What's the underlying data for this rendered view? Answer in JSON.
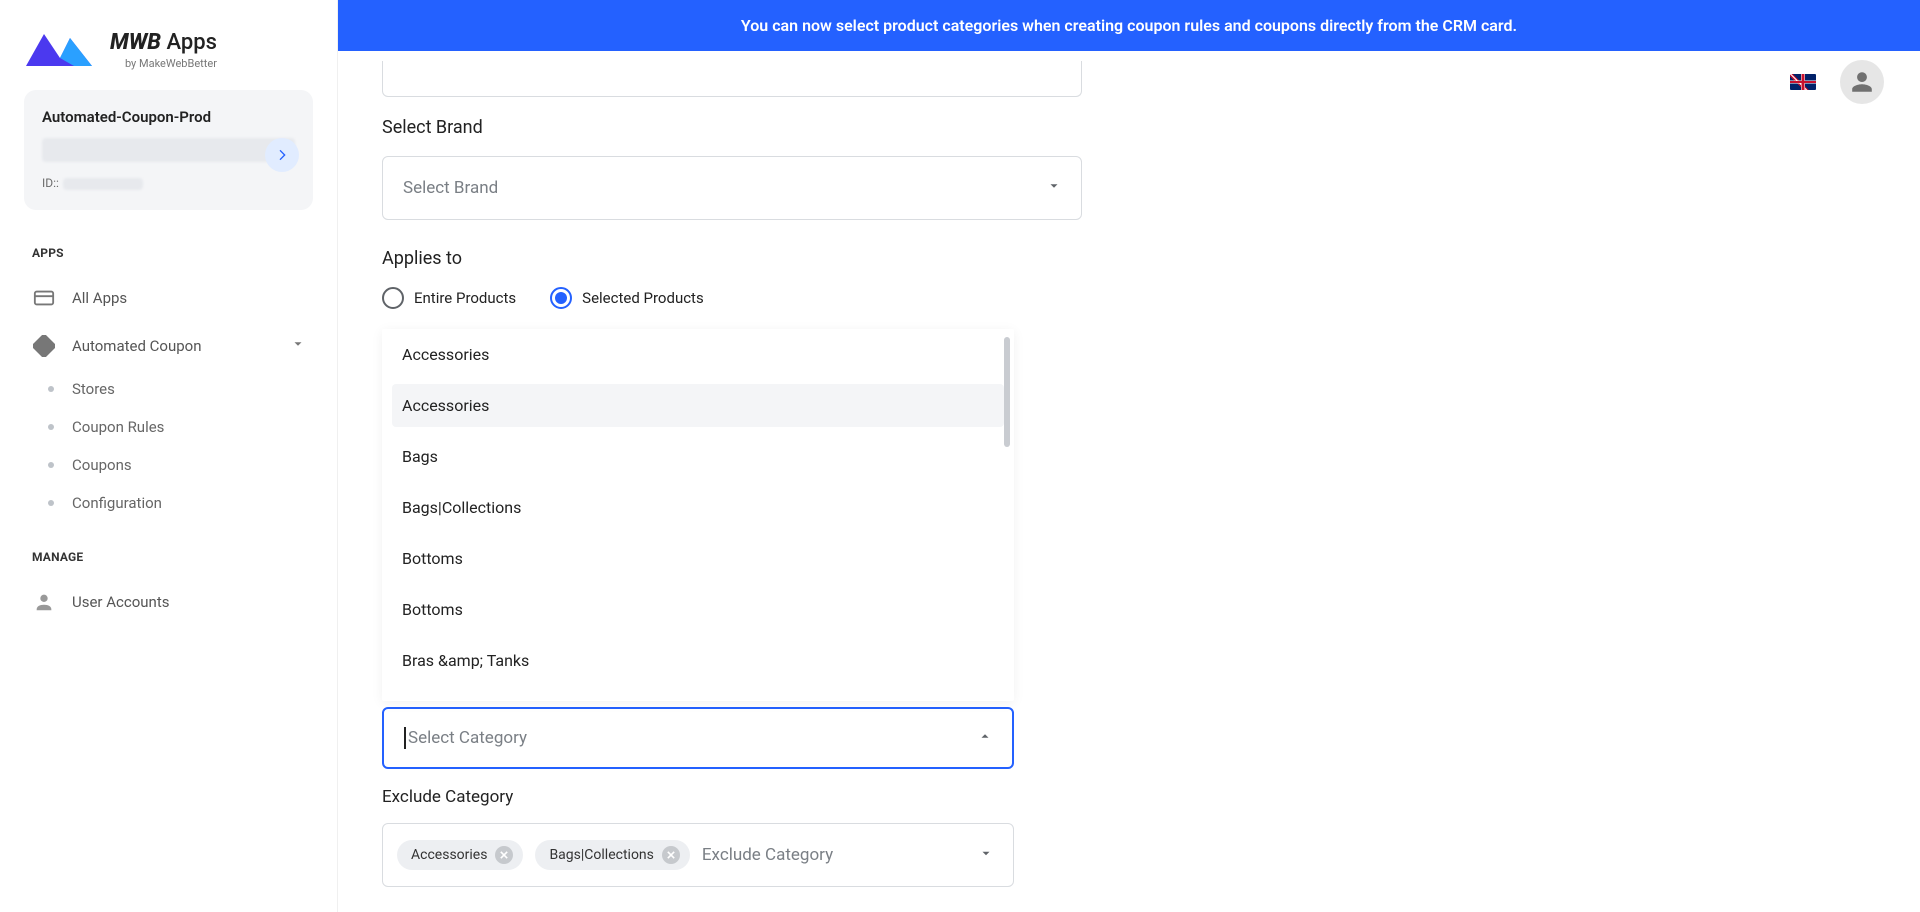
{
  "banner": {
    "text": "You can now select product categories when creating coupon rules and coupons directly from the CRM card."
  },
  "brand": {
    "title_strong": "MWB",
    "title_light": "Apps",
    "subtitle": "by MakeWebBetter"
  },
  "account": {
    "title": "Automated-Coupon-Prod",
    "id_label": "ID::"
  },
  "sidebar": {
    "section_apps": "APPS",
    "all_apps": "All Apps",
    "automated_coupon": "Automated Coupon",
    "sub_stores": "Stores",
    "sub_coupon_rules": "Coupon Rules",
    "sub_coupons": "Coupons",
    "sub_configuration": "Configuration",
    "section_manage": "MANAGE",
    "user_accounts": "User Accounts"
  },
  "form": {
    "select_brand_label": "Select Brand",
    "select_brand_placeholder": "Select Brand",
    "applies_to_label": "Applies to",
    "radio_entire": "Entire Products",
    "radio_selected": "Selected Products",
    "select_category": {
      "placeholder": "Select Category",
      "options": [
        "Accessories",
        "Accessories",
        "Bags",
        "Bags|Collections",
        "Bottoms",
        "Bottoms",
        "Bras &amp; Tanks"
      ]
    },
    "exclude_category": {
      "label": "Exclude Category",
      "placeholder": "Exclude Category",
      "chips": [
        "Accessories",
        "Bags|Collections"
      ]
    }
  }
}
